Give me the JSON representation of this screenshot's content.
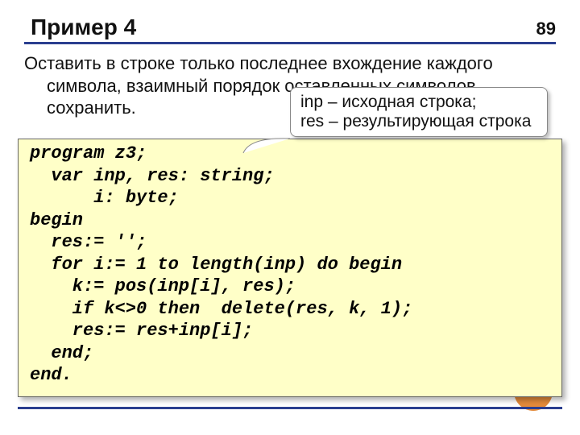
{
  "page_number": "89",
  "title": "Пример 4",
  "task_line1": "Оставить в строке только последнее вхождение каждого",
  "task_line2": "символа, взаимный порядок оставленных символов",
  "task_line3": "сохранить.",
  "callout_line1": "inp – исходная строка;",
  "callout_line2": "res – результирующая строка",
  "code": "program z3;\n  var inp, res: string;\n      i: byte;\nbegin\n  res:= '';\n  for i:= 1 to length(inp) do begin\n    k:= pos(inp[i], res);\n    if k<>0 then  delete(res, k, 1);\n    res:= res+inp[i];\n  end;\nend."
}
